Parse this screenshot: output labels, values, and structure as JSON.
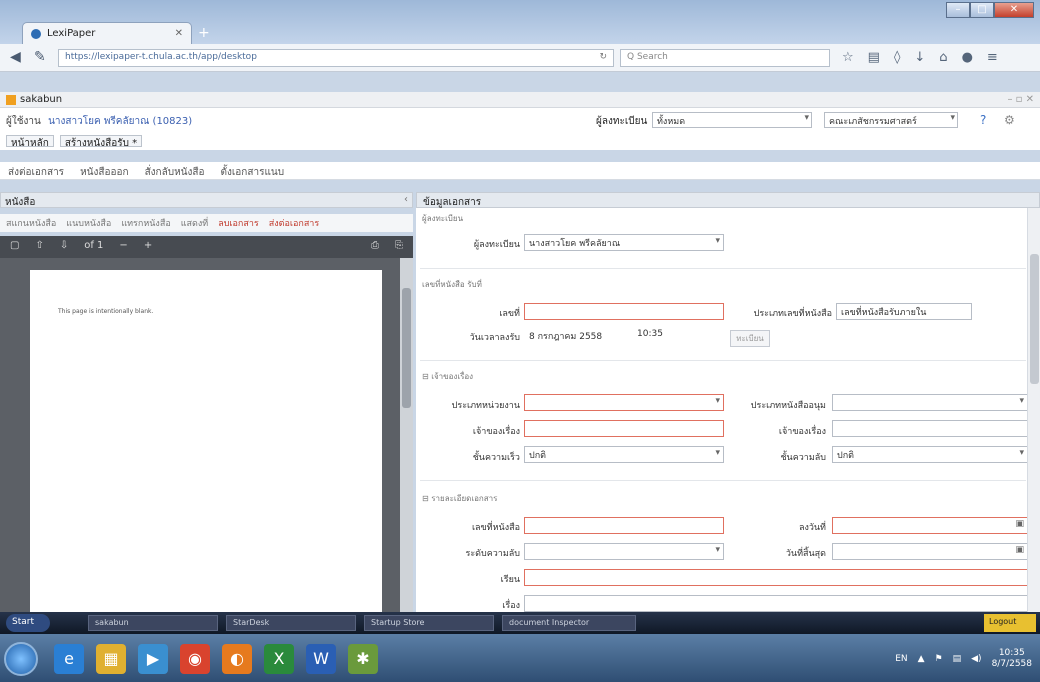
{
  "browser": {
    "tab_title": "LexiPaper",
    "new_tab": "+",
    "url": "https://lexipaper-t.chula.ac.th/app/desktop",
    "search_placeholder": "Q Search",
    "reload": "↻"
  },
  "app": {
    "window_title": "sakabun",
    "user_label": "ผู้ใช้งาน",
    "user_name": "นางสาวโยค พรีคลัยาณ (10823)",
    "dept_label": "ผู้ลงทะเบียน",
    "dept_value": "ทั้งหมด",
    "org_value": "คณะเภสัชกรรมศาสตร์",
    "tabs": [
      "หน้าหลัก",
      "สร้างหนังสือรับ *"
    ],
    "actions": [
      "ส่งต่อเอกสาร",
      "หนังสือออก",
      "สั่งกลับหนังสือ",
      "ตั้งเอกสารแนบ"
    ]
  },
  "left": {
    "header": "หนังสือ",
    "tools": [
      "สแกนหนังสือ",
      "แนบหนังสือ",
      "แทรกหนังสือ",
      "แสดงที่",
      "ลบเอกสาร",
      "ส่งต่อเอกสาร"
    ],
    "page_info": "of 1",
    "pdf_message": "This page is intentionally blank."
  },
  "right": {
    "header": "ข้อมูลเอกสาร",
    "sections": {
      "registrar": "ผู้ลงทะเบียน",
      "book_no": "เลขที่หนังสือ รับที่",
      "origin": "เจ้าของเรื่อง",
      "details": "รายละเอียดเอกสาร"
    },
    "registrar_label": "ผู้ลงทะเบียน",
    "registrar_value": "นางสาวโยค พรีคลัยาณ",
    "number_label": "เลขที่",
    "number_value": "",
    "type_label": "ประเภทเลขที่หนังสือ",
    "type_value": "เลขที่หนังสือรับภายใน",
    "date_label": "วันเวลาลงรับ",
    "date_value": "8 กรกฎาคม 2558",
    "time_value": "10:35",
    "date_btn": "ทะเบียน",
    "fields": {
      "org_type_label": "ประเภทหน่วยงาน",
      "org_type_value": "",
      "book_type_label": "ประเภทหนังสืออนุม",
      "book_type_value": "",
      "owner_label": "เจ้าของเรื่อง",
      "owner_value": "",
      "owner2_label": "เจ้าของเรื่อง",
      "owner2_value": "",
      "urgency_label": "ชั้นความเร็ว",
      "urgency_value": "ปกติ",
      "secrecy_label": "ชั้นความลับ",
      "secrecy_value": "ปกติ",
      "doc_no_label": "เลขที่หนังสือ",
      "doc_no_value": "",
      "date2_label": "ลงวันที่",
      "date2_value": "",
      "urgent_label": "ระดับความลับ",
      "urgent_value": "",
      "expire_label": "วันที่สิ้นสุด",
      "expire_value": "",
      "to_label": "เรียน",
      "to_value": "",
      "subject_label": "เรื่อง",
      "subject_value": ""
    }
  },
  "taskbar_app": {
    "start": "Start",
    "items": [
      "sakabun",
      "StarDesk",
      "Startup Store",
      "document Inspector"
    ],
    "logout": "Logout"
  },
  "taskbar_win": {
    "lang": "EN",
    "time": "10:35",
    "date": "8/7/2558"
  }
}
